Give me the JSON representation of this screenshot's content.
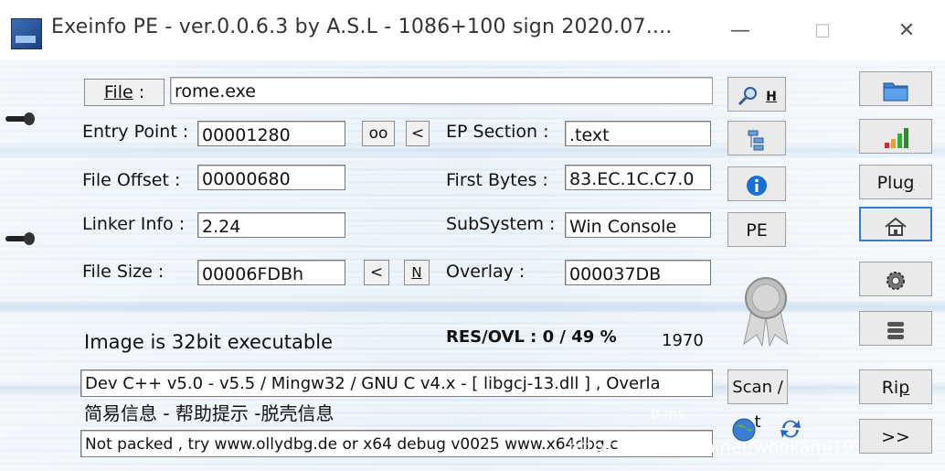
{
  "window": {
    "title": "Exeinfo PE - ver.0.0.6.3  by A.S.L -  1086+100 sign  2020.07....",
    "minimize": "—",
    "maximize": "☐",
    "close": "✕"
  },
  "file": {
    "button_prefix": "File",
    "button_suffix": " :",
    "value": "rome.exe"
  },
  "fields": {
    "entry_point_label": "Entry Point :",
    "entry_point_value": "00001280",
    "oo_button": "oo",
    "lt_button": "<",
    "ep_section_label": "EP Section :",
    "ep_section_value": ".text",
    "file_offset_label": "File Offset :",
    "file_offset_value": "00000680",
    "first_bytes_label": "First Bytes :",
    "first_bytes_value": "83.EC.1C.C7.0",
    "linker_info_label": "Linker Info :",
    "linker_info_value": "2.24",
    "subsystem_label": "SubSystem :",
    "subsystem_value": "Win Console",
    "file_size_label": "File Size :",
    "file_size_value": "00006FDBh",
    "size_lt_button": "<",
    "n_button": "N",
    "overlay_label": "Overlay :",
    "overlay_value": "000037DB"
  },
  "status": {
    "image_bits": "Image is 32bit executable",
    "res_ovl": "RES/OVL : 0 / 49 %",
    "year": "1970",
    "detection": "Dev C++ v5.0 - v5.5 / Mingw32 / GNU C v4.x - [ libgcj-13.dll ] , Overla",
    "hint_label": "简易信息 - 帮助提示 -脱壳信息",
    "time": "0 ms.",
    "advice": "Not packed , try  www.ollydbg.de or x64 debug v0025 www.x64dbg.c",
    "watermark": "https://blog.csdn.net/wookami1997"
  },
  "buttons": {
    "h_label": "H",
    "pe_label": "PE",
    "scan_label": "Scan / t",
    "plug_prefix": "Plu",
    "plug_underline": "g",
    "rip_prefix": "Ri",
    "rip_underline": "p",
    "more_label": ">>"
  },
  "icons": {
    "search": "magnifier-icon",
    "tree": "section-tree-icon",
    "info": "info-icon",
    "ribbon": "award-ribbon-icon",
    "globe": "globe-icon",
    "refresh": "refresh-icon",
    "folder": "folder-icon",
    "bars": "signal-bars-icon",
    "home": "home-icon",
    "gear": "gear-icon",
    "stack": "stack-icon"
  }
}
